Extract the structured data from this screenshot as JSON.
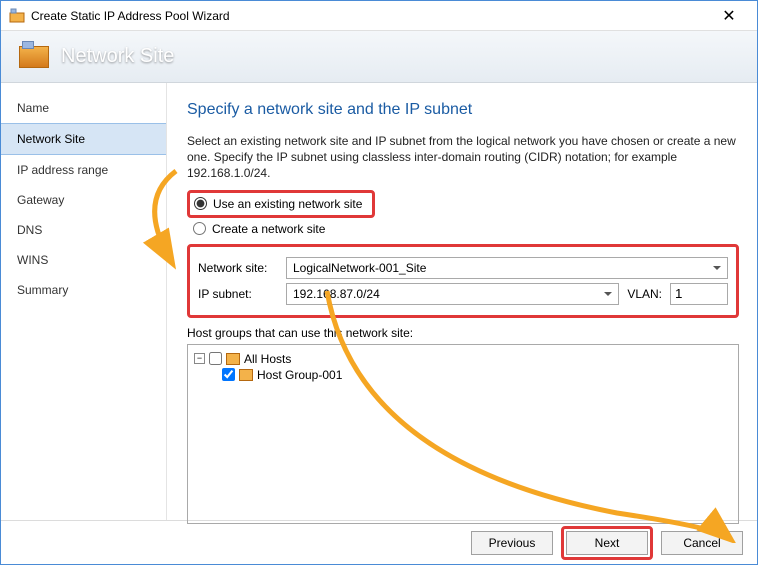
{
  "window": {
    "title": "Create Static IP Address Pool Wizard",
    "close_glyph": "✕"
  },
  "banner": {
    "title": "Network Site"
  },
  "sidebar": {
    "items": [
      {
        "label": "Name"
      },
      {
        "label": "Network Site"
      },
      {
        "label": "IP address range"
      },
      {
        "label": "Gateway"
      },
      {
        "label": "DNS"
      },
      {
        "label": "WINS"
      },
      {
        "label": "Summary"
      }
    ],
    "selected_index": 1
  },
  "main": {
    "heading": "Specify a network site and the IP subnet",
    "description": "Select an existing network site and IP subnet from the logical network you have chosen or create a new one. Specify the IP subnet using classless inter-domain routing (CIDR) notation; for example 192.168.1.0/24.",
    "radio_existing": "Use an existing network site",
    "radio_create": "Create a network site",
    "radio_selected": "existing",
    "network_site_label": "Network site:",
    "network_site_value": "LogicalNetwork-001_Site",
    "ip_subnet_label": "IP subnet:",
    "ip_subnet_value": "192.168.87.0/24",
    "vlan_label": "VLAN:",
    "vlan_value": "1",
    "hostgroups_label": "Host groups that can use this network site:",
    "tree": {
      "root": {
        "label": "All Hosts",
        "expanded": true,
        "checked": false
      },
      "child": {
        "label": "Host Group-001",
        "checked": true
      }
    }
  },
  "footer": {
    "previous": "Previous",
    "next": "Next",
    "cancel": "Cancel"
  }
}
